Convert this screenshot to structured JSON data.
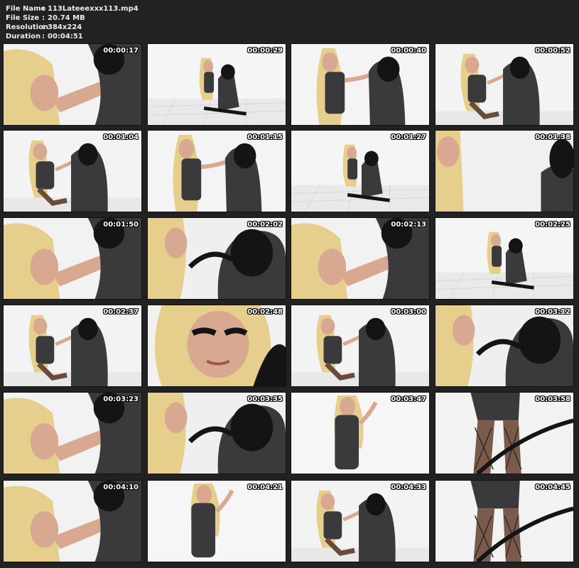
{
  "file_info": [
    {
      "label": "File Name",
      "separator": ":",
      "value": "113Lateeexxx113.mp4"
    },
    {
      "label": "File Size",
      "separator": ":",
      "value": "20.74 MB"
    },
    {
      "label": "Resolution",
      "separator": ":",
      "value": "384x224"
    },
    {
      "label": "Duration",
      "separator": ":",
      "value": "00:04:51"
    }
  ],
  "thumbnails": [
    {
      "timestamp": "00:00:17",
      "scene": "closeup-left"
    },
    {
      "timestamp": "00:00:29",
      "scene": "far-floor"
    },
    {
      "timestamp": "00:00:40",
      "scene": "mid-standing"
    },
    {
      "timestamp": "00:00:52",
      "scene": "mid-sitting"
    },
    {
      "timestamp": "00:01:04",
      "scene": "mid-sitting"
    },
    {
      "timestamp": "00:01:15",
      "scene": "mid-standing"
    },
    {
      "timestamp": "00:01:27",
      "scene": "far-floor"
    },
    {
      "timestamp": "00:01:38",
      "scene": "closeup-right"
    },
    {
      "timestamp": "00:01:50",
      "scene": "closeup-left"
    },
    {
      "timestamp": "00:02:02",
      "scene": "mask-closeup"
    },
    {
      "timestamp": "00:02:13",
      "scene": "closeup-left"
    },
    {
      "timestamp": "00:02:25",
      "scene": "far-floor"
    },
    {
      "timestamp": "00:02:37",
      "scene": "mid-sitting"
    },
    {
      "timestamp": "00:02:48",
      "scene": "face-closeup"
    },
    {
      "timestamp": "00:03:00",
      "scene": "mid-sitting"
    },
    {
      "timestamp": "00:03:12",
      "scene": "mask-closeup"
    },
    {
      "timestamp": "00:03:23",
      "scene": "closeup-left"
    },
    {
      "timestamp": "00:03:35",
      "scene": "mask-closeup"
    },
    {
      "timestamp": "00:03:47",
      "scene": "standing-center"
    },
    {
      "timestamp": "00:03:58",
      "scene": "legs"
    },
    {
      "timestamp": "00:04:10",
      "scene": "closeup-left"
    },
    {
      "timestamp": "00:04:21",
      "scene": "standing-center"
    },
    {
      "timestamp": "00:04:33",
      "scene": "mid-sitting"
    },
    {
      "timestamp": "00:04:45",
      "scene": "legs"
    }
  ],
  "colors": {
    "background": "#222222",
    "header_text": "#ececec",
    "thumb_bg": "#f4f4f4",
    "blonde": "#e6cf8c",
    "skin": "#d9a890",
    "latex": "#3a3a3c",
    "mask": "#141414"
  }
}
